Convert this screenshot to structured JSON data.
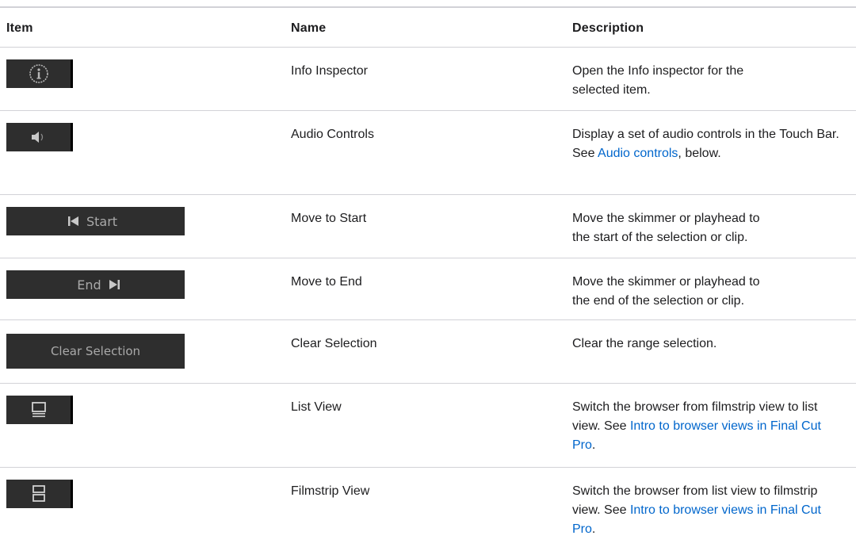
{
  "header": {
    "item": "Item",
    "name": "Name",
    "description": "Description"
  },
  "rows": [
    {
      "name": "Info Inspector",
      "icon": "info-icon",
      "desc": [
        {
          "t": "Open the Info inspector for the"
        },
        {
          "t": "selected item."
        }
      ]
    },
    {
      "name": "Audio Controls",
      "icon": "speaker-icon",
      "desc_pre": "Display a set of audio controls in the Touch Bar. See ",
      "link": "Audio controls",
      "desc_post": ", below."
    },
    {
      "name": "Move to Start",
      "icon": "skip-back-icon",
      "button_label": "Start",
      "desc": [
        {
          "t": "Move the skimmer or playhead to"
        },
        {
          "t": "the start of the selection or clip."
        }
      ]
    },
    {
      "name": "Move to End",
      "icon": "skip-forward-icon",
      "button_label": "End",
      "desc": [
        {
          "t": "Move the skimmer or playhead to"
        },
        {
          "t": "the end of the selection or clip."
        }
      ]
    },
    {
      "name": "Clear Selection",
      "button_label": "Clear Selection",
      "desc": [
        {
          "t": "Clear the range selection."
        }
      ]
    },
    {
      "name": "List View",
      "icon": "list-view-icon",
      "desc_pre": "Switch the browser from filmstrip view to list view. See ",
      "link": "Intro to browser views in Final Cut Pro",
      "desc_post": "."
    },
    {
      "name": "Filmstrip View",
      "icon": "filmstrip-view-icon",
      "desc_pre": "Switch the browser from list view to filmstrip view. See ",
      "link": "Intro to browser views in Final Cut Pro",
      "desc_post": "."
    }
  ],
  "colors": {
    "link": "#0066cc",
    "button_bg": "#2e2e2e",
    "rule": "#d2d2d7"
  }
}
